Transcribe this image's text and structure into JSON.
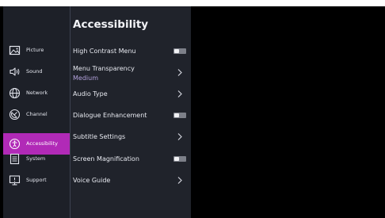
{
  "sidebar": {
    "items": [
      {
        "label": "Picture",
        "icon": "picture-icon",
        "active": false
      },
      {
        "label": "Sound",
        "icon": "speaker-icon",
        "active": false
      },
      {
        "label": "Network",
        "icon": "globe-icon",
        "active": false
      },
      {
        "label": "Channel",
        "icon": "satellite-dish-icon",
        "active": false
      },
      {
        "label": "Accessibility",
        "icon": "accessibility-icon",
        "active": true
      },
      {
        "label": "System",
        "icon": "system-icon",
        "active": false
      },
      {
        "label": "Support",
        "icon": "support-tv-icon",
        "active": false
      }
    ]
  },
  "panel": {
    "title": "Accessibility",
    "items": [
      {
        "label": "High Contrast Menu",
        "control": "toggle",
        "on": false
      },
      {
        "label": "Menu Transparency",
        "value": "Medium",
        "control": "chevron"
      },
      {
        "label": "Audio Type",
        "control": "chevron"
      },
      {
        "label": "Dialogue Enhancement",
        "control": "toggle",
        "on": false
      },
      {
        "label": "Subtitle Settings",
        "control": "chevron"
      },
      {
        "label": "Screen Magnification",
        "control": "toggle",
        "on": false
      },
      {
        "label": "Voice Guide",
        "control": "chevron"
      }
    ]
  },
  "colors": {
    "accent": "#b12ab7",
    "sidebar_bg": "#1d2028",
    "panel_bg": "#20232b",
    "value_text": "#b3a2dc"
  }
}
